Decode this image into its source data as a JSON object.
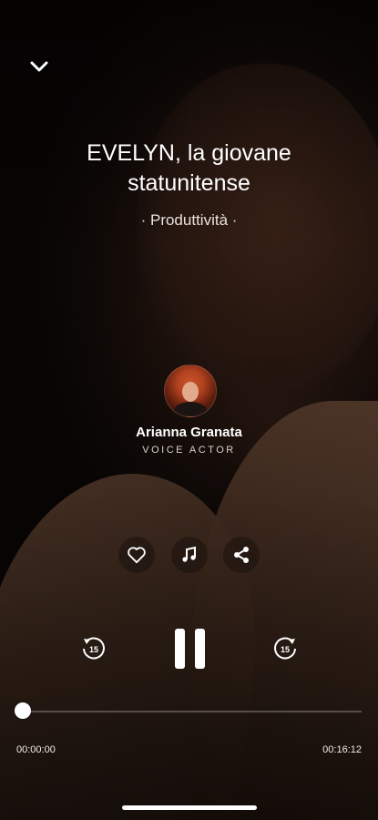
{
  "header": {
    "collapse_icon": "chevron-down-icon"
  },
  "episode": {
    "title": "EVELYN, la giovane statunitense",
    "category": "· Produttività ·"
  },
  "narrator": {
    "name": "Arianna Granata",
    "role": "VOICE ACTOR"
  },
  "actions": {
    "like_icon": "heart-icon",
    "music_icon": "music-note-icon",
    "share_icon": "share-icon"
  },
  "controls": {
    "back_icon": "rewind-15-icon",
    "pause_icon": "pause-icon",
    "forward_icon": "forward-15-icon",
    "skip_seconds": "15"
  },
  "progress": {
    "current": "00:00:00",
    "total": "00:16:12",
    "fraction": 0.0
  },
  "colors": {
    "accent": "#ffffff",
    "background": "#120b08"
  }
}
